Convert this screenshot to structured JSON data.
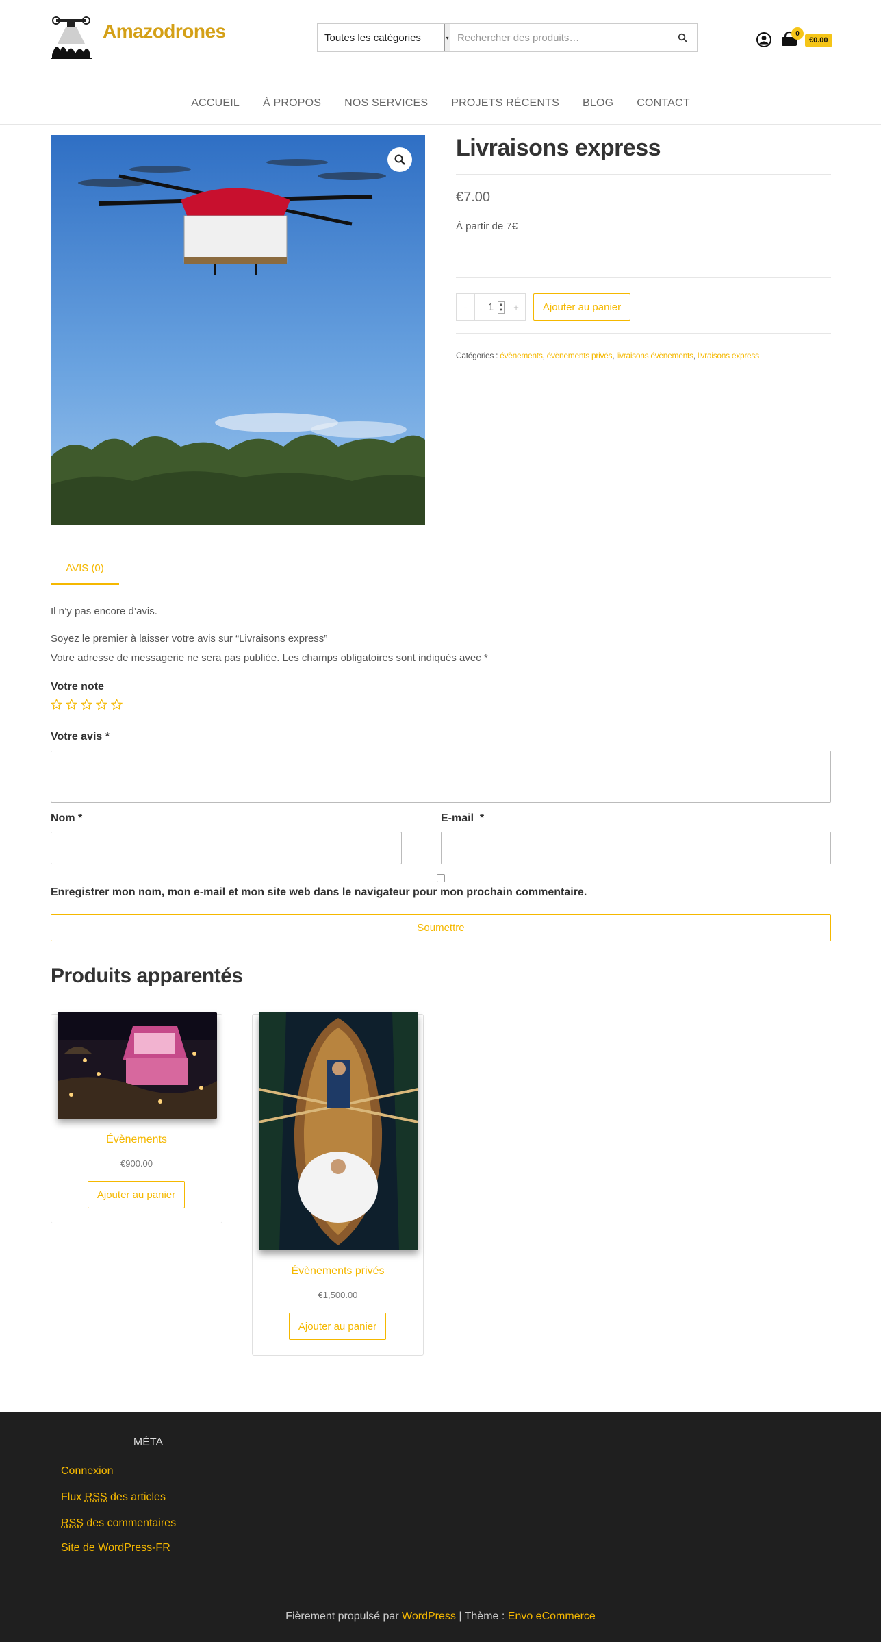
{
  "site": {
    "title": "Amazodrones"
  },
  "search": {
    "category_selected": "Toutes les catégories",
    "placeholder": "Rechercher des produits…"
  },
  "cart": {
    "count": "0",
    "total": "€0.00"
  },
  "nav": [
    "ACCUEIL",
    "À PROPOS",
    "NOS SERVICES",
    "PROJETS RÉCENTS",
    "BLOG",
    "CONTACT"
  ],
  "product": {
    "title": "Livraisons express",
    "price": "€7.00",
    "short_description": "À partir de 7€",
    "quantity": "1",
    "add_to_cart": "Ajouter au panier",
    "categories_label": "Catégories :",
    "categories": [
      "évènements",
      "évènements privés",
      "livraisons évènements",
      "livraisons express"
    ]
  },
  "tabs": {
    "reviews": "AVIS (0)"
  },
  "reviews": {
    "none": "Il n’y pas encore d’avis.",
    "reply_title": "Soyez le premier à laisser votre avis sur “Livraisons express”",
    "notes": "Votre adresse de messagerie ne sera pas publiée. Les champs obligatoires sont indiqués avec *",
    "rating_label": "Votre note",
    "review_label": "Votre avis",
    "name_label": "Nom",
    "email_label": "E-mail",
    "required_mark": "*",
    "consent": "Enregistrer mon nom, mon e-mail et mon site web dans le navigateur pour mon prochain commentaire.",
    "submit": "Soumettre"
  },
  "related": {
    "title": "Produits apparentés",
    "items": [
      {
        "name": "Évènements",
        "price": "€900.00",
        "button": "Ajouter au panier"
      },
      {
        "name": "Évènements privés",
        "price": "€1,500.00",
        "button": "Ajouter au panier"
      }
    ]
  },
  "footer": {
    "widget_title": "MÉTA",
    "links": [
      {
        "pre": "",
        "abbr": "",
        "post": "Connexion"
      },
      {
        "pre": "Flux ",
        "abbr": "RSS",
        "post": " des articles"
      },
      {
        "pre": "",
        "abbr": "RSS",
        "post": " des commentaires"
      },
      {
        "pre": "",
        "abbr": "",
        "post": "Site de WordPress-FR"
      }
    ],
    "credits_prefix": "Fièrement propulsé par ",
    "credits_wp": "WordPress",
    "credits_sep": " | Thème : ",
    "credits_theme": "Envo eCommerce"
  },
  "colors": {
    "accent": "#f5b800",
    "brand": "#d4a017",
    "footer_bg": "#1f1f1f"
  },
  "icons": [
    "zoom-icon",
    "search-icon",
    "user-icon",
    "cart-icon",
    "star-icon"
  ]
}
